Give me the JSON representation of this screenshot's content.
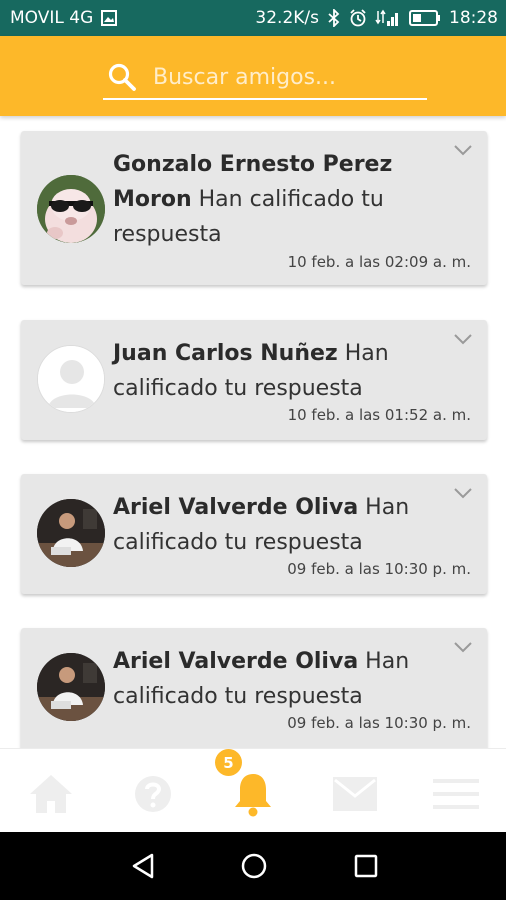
{
  "status_bar": {
    "carrier": "MOVIL 4G",
    "speed": "32.2K/s",
    "time": "18:28"
  },
  "search": {
    "placeholder": "Buscar amigos..."
  },
  "notifications": [
    {
      "name": "Gonzalo Ernesto Perez Moron",
      "message": "Han calificado tu respuesta",
      "time": "10 feb. a las 02:09 a. m.",
      "avatar": "dog-with-sunglasses"
    },
    {
      "name": "Juan Carlos Nuñez",
      "message": "Han calificado tu respuesta",
      "time": "10 feb. a las 01:52 a. m.",
      "avatar": "default-user"
    },
    {
      "name": "Ariel Valverde Oliva",
      "message": "Han calificado tu respuesta",
      "time": "09 feb. a las 10:30 p. m.",
      "avatar": "person-photo"
    },
    {
      "name": "Ariel Valverde Oliva",
      "message": "Han calificado tu respuesta",
      "time": "09 feb. a las 10:30 p. m.",
      "avatar": "person-photo"
    }
  ],
  "bottom_nav": {
    "items": [
      "home-icon",
      "help-icon",
      "bell-icon",
      "mail-icon",
      "menu-icon"
    ],
    "active": "bell-icon",
    "notification_count": "5"
  },
  "colors": {
    "status_bar": "#17695f",
    "accent": "#fdb829",
    "card": "#e7e7e7",
    "inactive_icon": "#eeeeee"
  }
}
